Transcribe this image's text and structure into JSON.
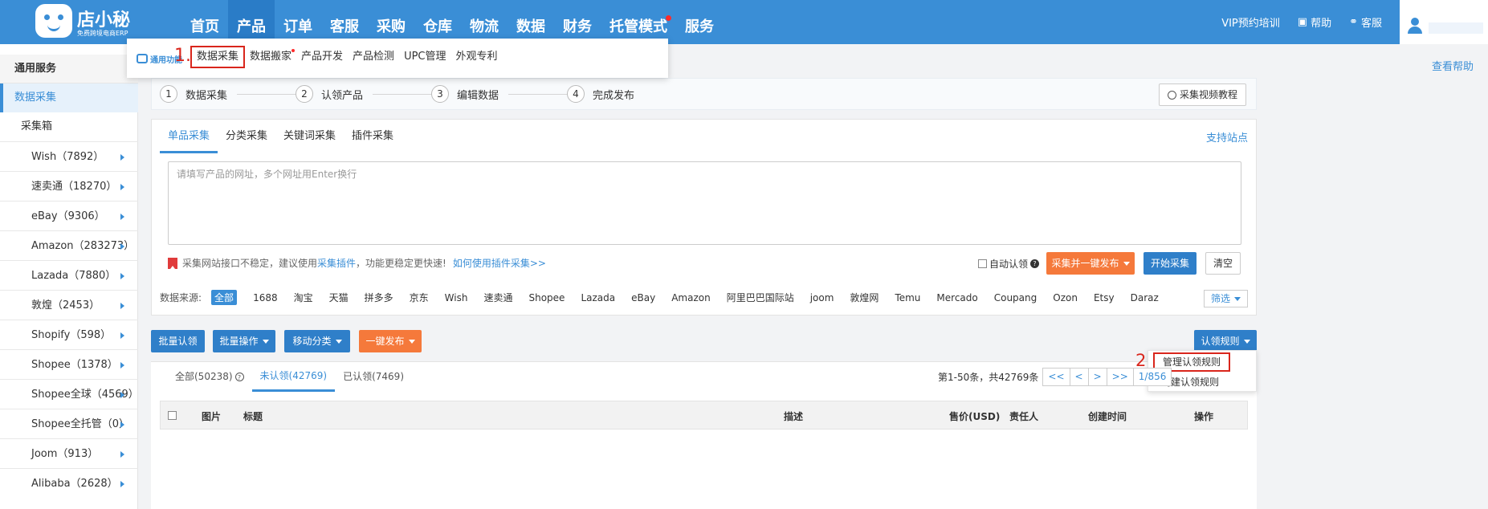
{
  "header": {
    "logo_title": "店小秘",
    "logo_subtitle": "免费跨境电商ERP",
    "nav": [
      {
        "label": "首页"
      },
      {
        "label": "产品"
      },
      {
        "label": "订单"
      },
      {
        "label": "客服"
      },
      {
        "label": "采购"
      },
      {
        "label": "仓库"
      },
      {
        "label": "物流"
      },
      {
        "label": "数据"
      },
      {
        "label": "财务"
      },
      {
        "label": "托管模式"
      },
      {
        "label": "服务"
      }
    ],
    "active_nav": "产品",
    "vip": "VIP预约培训",
    "help": "帮助",
    "service": "客服"
  },
  "product_menu": {
    "tag": "通用功能",
    "marker": "1.",
    "items": [
      {
        "label": "数据采集"
      },
      {
        "label": "数据搬家"
      },
      {
        "label": "产品开发"
      },
      {
        "label": "产品检测"
      },
      {
        "label": "UPC管理"
      },
      {
        "label": "外观专利"
      }
    ],
    "highlighted": "数据采集"
  },
  "help_link": "查看帮助",
  "sidebar": {
    "section_title": "通用服务",
    "selected": "数据采集",
    "collect_box": "采集箱",
    "platforms": [
      {
        "label": "Wish（7892）"
      },
      {
        "label": "速卖通（18270）"
      },
      {
        "label": "eBay（9306）"
      },
      {
        "label": "Amazon（283273）"
      },
      {
        "label": "Lazada（7880）"
      },
      {
        "label": "敦煌（2453）"
      },
      {
        "label": "Shopify（598）"
      },
      {
        "label": "Shopee（1378）"
      },
      {
        "label": "Shopee全球（4569）"
      },
      {
        "label": "Shopee全托管（0）"
      },
      {
        "label": "Joom（913）"
      },
      {
        "label": "Alibaba（2628）"
      }
    ]
  },
  "steps": [
    {
      "num": "1",
      "label": "数据采集"
    },
    {
      "num": "2",
      "label": "认领产品"
    },
    {
      "num": "3",
      "label": "编辑数据"
    },
    {
      "num": "4",
      "label": "完成发布"
    }
  ],
  "video_tutorial": "采集视频教程",
  "collect": {
    "tabs": [
      {
        "label": "单品采集"
      },
      {
        "label": "分类采集"
      },
      {
        "label": "关键词采集"
      },
      {
        "label": "插件采集"
      }
    ],
    "active_tab": "单品采集",
    "support_sites": "支持站点",
    "url_placeholder": "请填写产品的网址，多个网址用Enter换行",
    "notice_text": "采集网站接口不稳定，建议使用",
    "notice_link": "采集插件",
    "notice_suffix": "，功能更稳定更快速!",
    "howto_link": "如何使用插件采集>>",
    "auto_claim": "自动认领",
    "collect_publish": "采集并一键发布",
    "start_collect": "开始采集",
    "clear": "清空"
  },
  "sources": {
    "label": "数据来源:",
    "items": [
      "全部",
      "1688",
      "淘宝",
      "天猫",
      "拼多多",
      "京东",
      "Wish",
      "速卖通",
      "Shopee",
      "Lazada",
      "eBay",
      "Amazon",
      "阿里巴巴国际站",
      "joom",
      "敦煌网",
      "Temu",
      "Mercado",
      "Coupang",
      "Ozon",
      "Etsy",
      "Daraz"
    ],
    "active": "全部",
    "filter": "筛选"
  },
  "toolbar": {
    "batch_claim": "批量认领",
    "batch_ops": "批量操作",
    "move_category": "移动分类",
    "one_click_publish": "一键发布",
    "claim_rules": "认领规则"
  },
  "rules_menu": {
    "marker": "2.",
    "manage": "管理认领规则",
    "create": "创建认领规则"
  },
  "list": {
    "tabs": [
      {
        "label": "全部(50238)"
      },
      {
        "label": "未认领(42769)"
      },
      {
        "label": "已认领(7469)"
      }
    ],
    "active_tab": "未认领(42769)",
    "pager_text": "第1-50条，共42769条",
    "pager_buttons": [
      "<<",
      "<",
      ">",
      ">>",
      "1/856"
    ],
    "columns": [
      "图片",
      "标题",
      "描述",
      "售价(USD)",
      "责任人",
      "创建时间",
      "操作"
    ]
  },
  "colors": {
    "primary": "#3a8ed6",
    "orange": "#f5793b",
    "highlight_red": "#d9261c"
  }
}
